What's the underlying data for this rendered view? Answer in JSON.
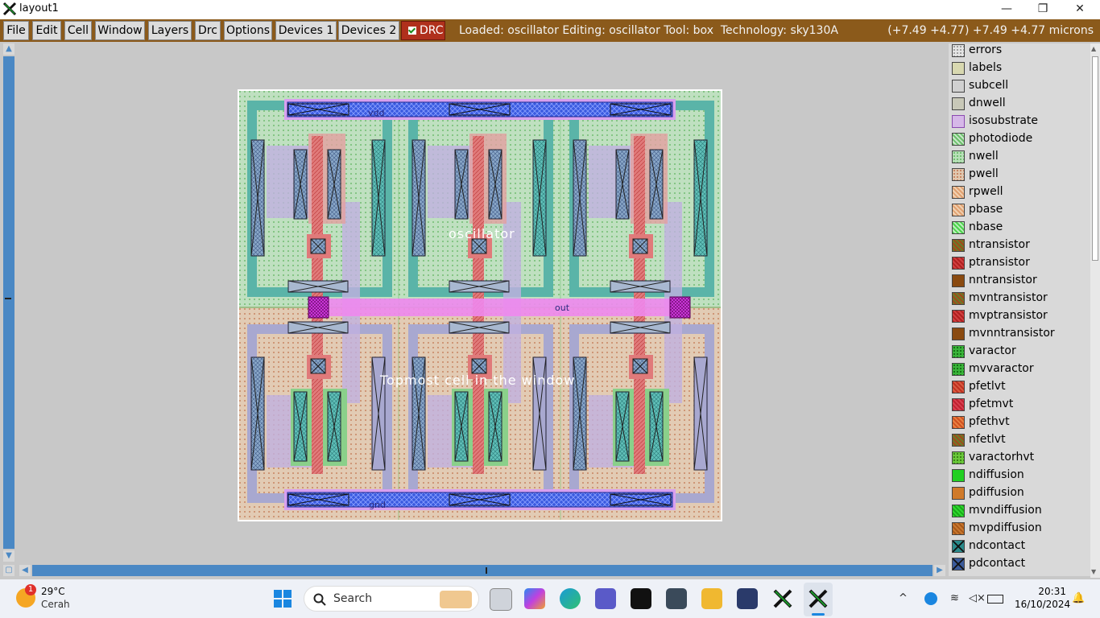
{
  "window": {
    "title": "layout1",
    "minimize": "—",
    "maximize": "❐",
    "close": "✕"
  },
  "menu": [
    "File",
    "Edit",
    "Cell",
    "Window",
    "Layers",
    "Drc",
    "Options",
    "Devices 1",
    "Devices 2"
  ],
  "drc_label": "DRC",
  "status_text": "Loaded: oscillator Editing: oscillator Tool: box  Technology: sky130A",
  "coords_text": "(+7.49 +4.77) +7.49 +4.77 microns",
  "canvas": {
    "cell_name": "oscillator",
    "window_hint": "Topmost cell in the window",
    "labels": {
      "vdd": "vdd",
      "out": "out",
      "gnd": "gnd"
    }
  },
  "layers": [
    {
      "name": "errors",
      "color": "#e0e0e0"
    },
    {
      "name": "labels",
      "color": "#d8d8b0"
    },
    {
      "name": "subcell",
      "color": "#d0d0d0"
    },
    {
      "name": "dnwell",
      "color": "#c8c8b8"
    },
    {
      "name": "isosubstrate",
      "color": "#d6b8e8"
    },
    {
      "name": "photodiode",
      "color": "#6bbf6b"
    },
    {
      "name": "nwell",
      "color": "#b8e0b8"
    },
    {
      "name": "pwell",
      "color": "#e0c8b0"
    },
    {
      "name": "rpwell",
      "color": "#e0a070"
    },
    {
      "name": "pbase",
      "color": "#e0a070"
    },
    {
      "name": "nbase",
      "color": "#4cd24c"
    },
    {
      "name": "ntransistor",
      "color": "#6a7a2a"
    },
    {
      "name": "ptransistor",
      "color": "#b02020"
    },
    {
      "name": "nntransistor",
      "color": "#8a4a10"
    },
    {
      "name": "mvntransistor",
      "color": "#6a7a2a"
    },
    {
      "name": "mvptransistor",
      "color": "#b02020"
    },
    {
      "name": "mvnntransistor",
      "color": "#8a4a10"
    },
    {
      "name": "varactor",
      "color": "#3ab43a"
    },
    {
      "name": "mvvaractor",
      "color": "#3ab43a"
    },
    {
      "name": "pfetlvt",
      "color": "#c03020"
    },
    {
      "name": "pfetmvt",
      "color": "#c02030"
    },
    {
      "name": "pfethvt",
      "color": "#d05020"
    },
    {
      "name": "nfetlvt",
      "color": "#6a7a2a"
    },
    {
      "name": "varactorhvt",
      "color": "#6ac83a"
    },
    {
      "name": "ndiffusion",
      "color": "#22d022"
    },
    {
      "name": "pdiffusion",
      "color": "#d07a2a"
    },
    {
      "name": "mvndiffusion",
      "color": "#30d830"
    },
    {
      "name": "mvpdiffusion",
      "color": "#c87830"
    },
    {
      "name": "ndcontact",
      "color": "#2a8a8a"
    },
    {
      "name": "pdcontact",
      "color": "#3a5a9a"
    }
  ],
  "taskbar": {
    "weather_temp": "29°C",
    "weather_cond": "Cerah",
    "weather_badge": "1",
    "search_label": "Search",
    "time": "20:31",
    "date": "16/10/2024"
  }
}
